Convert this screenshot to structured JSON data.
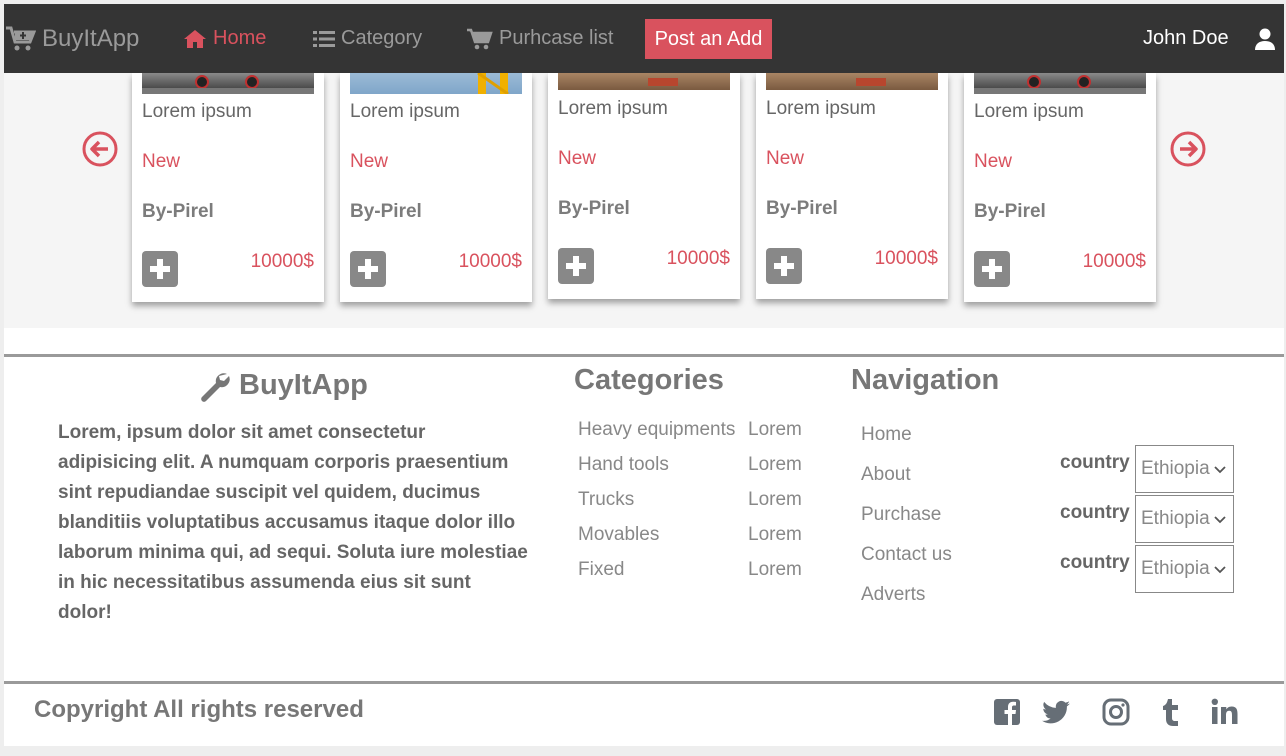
{
  "navbar": {
    "brand": "BuyItApp",
    "home": "Home",
    "category": "Category",
    "purchase_list": "Purhcase list",
    "post_button": "Post an Add",
    "user_name": "John Doe"
  },
  "carousel": {
    "cards": [
      {
        "title": "Lorem ipsum",
        "condition": "New",
        "seller": "By-Pirel",
        "price": "10000$"
      },
      {
        "title": "Lorem ipsum",
        "condition": "New",
        "seller": "By-Pirel",
        "price": "10000$"
      },
      {
        "title": "Lorem ipsum",
        "condition": "New",
        "seller": "By-Pirel",
        "price": "10000$"
      },
      {
        "title": "Lorem ipsum",
        "condition": "New",
        "seller": "By-Pirel",
        "price": "10000$"
      },
      {
        "title": "Lorem ipsum",
        "condition": "New",
        "seller": "By-Pirel",
        "price": "10000$"
      }
    ]
  },
  "footer": {
    "brand": "BuyItApp",
    "description": "Lorem, ipsum dolor sit amet consectetur adipisicing elit. A numquam corporis praesentium sint repudiandae suscipit vel quidem, ducimus blanditiis voluptatibus accusamus itaque dolor illo laborum minima qui, ad sequi. Soluta iure molestiae in hic necessitatibus assumenda eius sit sunt dolor!",
    "categories_title": "Categories",
    "categories": [
      "Heavy equipments",
      "Hand tools",
      "Trucks",
      "Movables",
      "Fixed"
    ],
    "categories_extra": [
      "Lorem",
      "Lorem",
      "Lorem",
      "Lorem",
      "Lorem"
    ],
    "navigation_title": "Navigation",
    "navigation": [
      "Home",
      "About",
      "Purchase",
      "Contact us",
      "Adverts"
    ],
    "country_selects": [
      {
        "label": "country",
        "value": "Ethiopia"
      },
      {
        "label": "country",
        "value": "Ethiopia"
      },
      {
        "label": "country",
        "value": "Ethiopia"
      }
    ],
    "copyright": "Copyright All rights reserved",
    "social_icons": [
      "facebook-icon",
      "twitter-icon",
      "instagram-icon",
      "tumblr-icon",
      "linkedin-icon"
    ]
  },
  "colors": {
    "accent": "#d9525e",
    "navbar_bg": "#343434",
    "muted_text": "#888888"
  }
}
